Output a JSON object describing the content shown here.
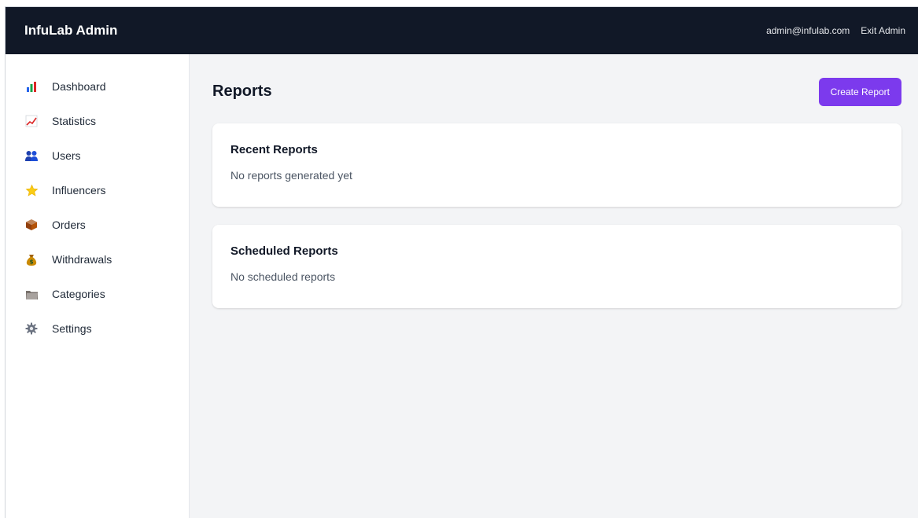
{
  "app": {
    "title": "InfuLab Admin",
    "user_email": "admin@infulab.com",
    "exit_label": "Exit Admin"
  },
  "sidebar": {
    "items": [
      {
        "label": "Dashboard",
        "icon": "bar-chart-icon"
      },
      {
        "label": "Statistics",
        "icon": "trend-chart-icon"
      },
      {
        "label": "Users",
        "icon": "users-icon"
      },
      {
        "label": "Influencers",
        "icon": "star-icon"
      },
      {
        "label": "Orders",
        "icon": "package-icon"
      },
      {
        "label": "Withdrawals",
        "icon": "money-bag-icon"
      },
      {
        "label": "Categories",
        "icon": "folder-icon"
      },
      {
        "label": "Settings",
        "icon": "gear-icon"
      }
    ]
  },
  "main": {
    "title": "Reports",
    "create_button": "Create Report",
    "cards": [
      {
        "title": "Recent Reports",
        "text": "No reports generated yet"
      },
      {
        "title": "Scheduled Reports",
        "text": "No scheduled reports"
      }
    ]
  },
  "colors": {
    "topbar": "#111827",
    "accent": "#7c3aed",
    "background": "#f3f4f6"
  }
}
